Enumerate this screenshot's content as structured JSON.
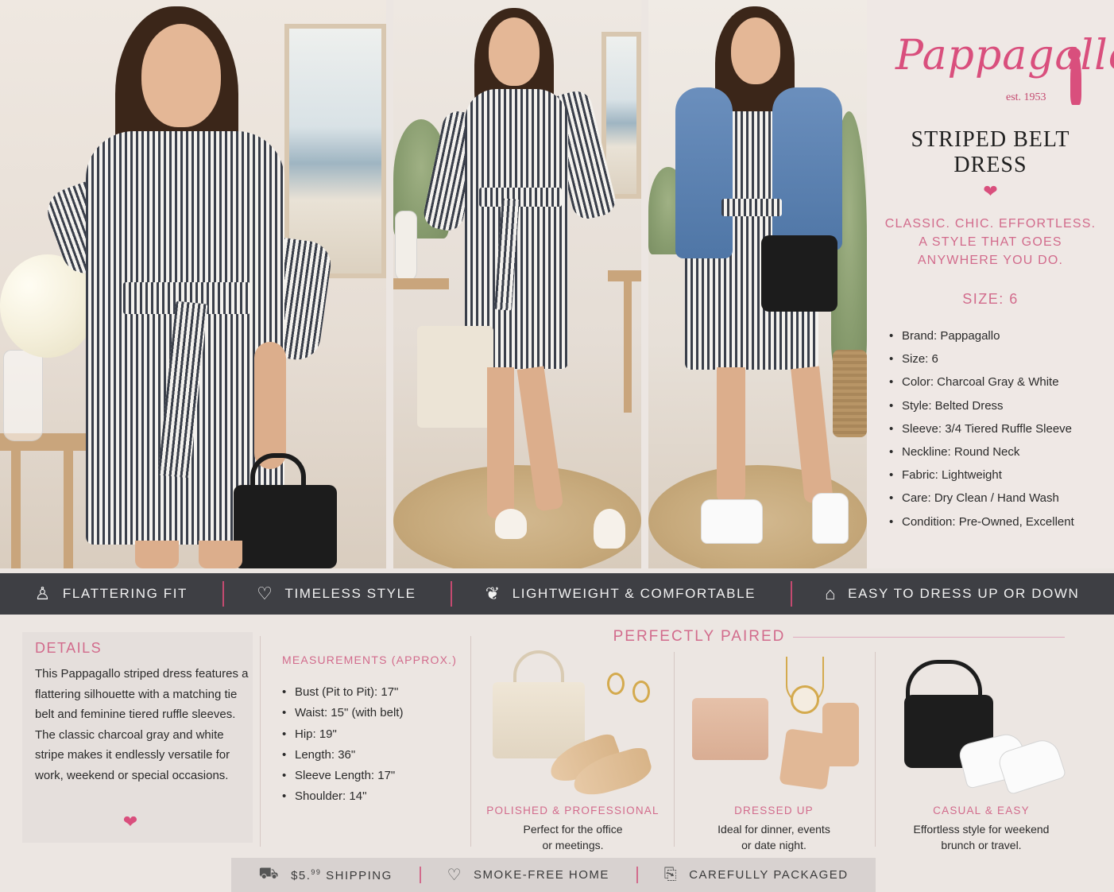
{
  "brand": {
    "logo_text": "Pappagallo",
    "est": "est. 1953",
    "accent_color": "#d94f7d"
  },
  "product": {
    "title": "STRIPED BELT DRESS",
    "tagline_line1": "CLASSIC. CHIC. EFFORTLESS.",
    "tagline_line2": "A STYLE THAT GOES",
    "tagline_line3": "ANYWHERE YOU DO.",
    "size_label": "SIZE: 6",
    "specs": [
      "Brand: Pappagallo",
      "Size: 6",
      "Color: Charcoal Gray & White",
      "Style: Belted Dress",
      "Sleeve: 3/4 Tiered Ruffle Sleeve",
      "Neckline: Round Neck",
      "Fabric: Lightweight",
      "Care: Dry Clean / Hand Wash",
      "Condition: Pre-Owned, Excellent"
    ]
  },
  "features": [
    {
      "icon": "dress-icon",
      "glyph": "♙",
      "label": "FLATTERING FIT"
    },
    {
      "icon": "heart-outline-icon",
      "glyph": "♡",
      "label": "TIMELESS STYLE"
    },
    {
      "icon": "leaf-icon",
      "glyph": "❦",
      "label": "LIGHTWEIGHT & COMFORTABLE"
    },
    {
      "icon": "hanger-icon",
      "glyph": "⌂",
      "label": "EASY TO DRESS UP OR DOWN"
    }
  ],
  "details": {
    "title": "DETAILS",
    "text": "This Pappagallo striped dress features a flattering silhouette with a matching tie belt and feminine tiered ruffle sleeves. The classic charcoal gray and white stripe makes it endlessly versatile for work, weekend or special occasions."
  },
  "measurements": {
    "title": "MEASUREMENTS (APPROX.)",
    "items": [
      "Bust (Pit to Pit): 17\"",
      "Waist: 15\" (with belt)",
      "Hip: 19\"",
      "Length: 36\"",
      "Sleeve Length: 17\"",
      "Shoulder: 14\""
    ]
  },
  "pairings": {
    "title": "PERFECTLY PAIRED",
    "items": [
      {
        "caption": "POLISHED & PROFESSIONAL",
        "desc_line1": "Perfect for the office",
        "desc_line2": "or meetings."
      },
      {
        "caption": "DRESSED UP",
        "desc_line1": "Ideal for dinner, events",
        "desc_line2": "or date night."
      },
      {
        "caption": "CASUAL & EASY",
        "desc_line1": "Effortless style for weekend",
        "desc_line2": "brunch or travel."
      }
    ]
  },
  "bottom_bar": [
    {
      "icon": "truck-icon",
      "glyph": "⛟",
      "label_prefix": "$5.",
      "label_sup": "99",
      "label_suffix": " SHIPPING"
    },
    {
      "icon": "heart-outline-icon",
      "glyph": "♡",
      "label": "SMOKE-FREE HOME"
    },
    {
      "icon": "gift-icon",
      "glyph": "⎘",
      "label": "CAREFULLY PACKAGED"
    }
  ]
}
